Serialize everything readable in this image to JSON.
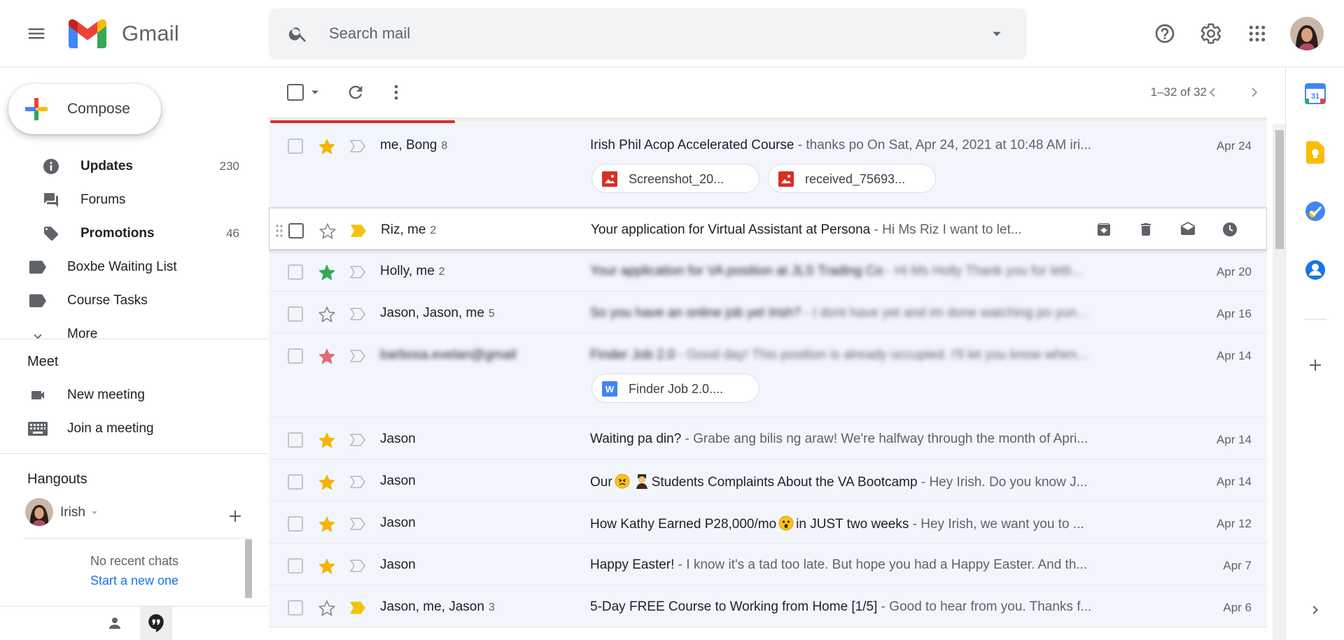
{
  "header": {
    "product_name": "Gmail",
    "search_placeholder": "Search mail"
  },
  "compose": {
    "label": "Compose"
  },
  "nav": {
    "items": [
      {
        "label": "Updates",
        "count": "230",
        "bold": true,
        "icon": "info-icon"
      },
      {
        "label": "Forums",
        "count": "",
        "bold": false,
        "icon": "forum-icon"
      },
      {
        "label": "Promotions",
        "count": "46",
        "bold": true,
        "icon": "tag-icon"
      },
      {
        "label": "Boxbe Waiting List",
        "count": "",
        "bold": false,
        "icon": "label-icon"
      },
      {
        "label": "Course Tasks",
        "count": "",
        "bold": false,
        "icon": "label-icon"
      },
      {
        "label": "More",
        "count": "",
        "bold": false,
        "icon": "chevron-down-icon"
      }
    ]
  },
  "meet": {
    "title": "Meet",
    "new_meeting": "New meeting",
    "join_meeting": "Join a meeting"
  },
  "hangouts": {
    "title": "Hangouts",
    "user_name": "Irish",
    "no_chats": "No recent chats",
    "start_new": "Start a new one"
  },
  "toolbar": {
    "pagination": "1–32 of 32"
  },
  "colors": {
    "star_yellow": "#f4b400",
    "star_green": "#34a853",
    "star_red": "#e56b6f",
    "important_yellow": "#f4c20d",
    "link_blue": "#1a73e8",
    "progress_red": "#d93025"
  },
  "messages": [
    {
      "sender": "me, Bong",
      "count": "8",
      "subject": "Irish Phil Acop Accelerated Course",
      "snippet": " - thanks po On Sat, Apr 24, 2021 at 10:48 AM iri...",
      "date": "Apr 24",
      "star": "yellow",
      "important": false,
      "blurred": false,
      "attachments": [
        {
          "name": "Screenshot_20...",
          "type": "image"
        },
        {
          "name": "received_75693...",
          "type": "image"
        }
      ]
    },
    {
      "sender": "Riz, me",
      "count": "2",
      "subject": "Your application for Virtual Assistant at Persona",
      "snippet": " - Hi Ms Riz I want to let...",
      "date": "",
      "star": "none",
      "important": true,
      "blurred": false,
      "hover": true,
      "attachments": []
    },
    {
      "sender": "Holly, me",
      "count": "2",
      "subject": "Your application for VA position at JLS Trading Co",
      "snippet": " - Hi Ms Holly Thank you for letti...",
      "date": "Apr 20",
      "star": "green",
      "important": false,
      "blurred": true,
      "attachments": []
    },
    {
      "sender": "Jason, Jason, me",
      "count": "5",
      "subject": "So you have an online job yet Irish?",
      "snippet": " - I dont have yet and im done watching po yun...",
      "date": "Apr 16",
      "star": "none",
      "important": false,
      "blurred": true,
      "attachments": []
    },
    {
      "sender": "barbosa.evelan@gmail",
      "count": "",
      "subject": "Finder Job 2.0",
      "snippet": " - Good day! This position is already occupied. I'll let you know when...",
      "date": "Apr 14",
      "star": "red",
      "important": false,
      "blurred": true,
      "sender_blurred": true,
      "attachments": [
        {
          "name": "Finder Job 2.0....",
          "type": "word"
        }
      ]
    },
    {
      "sender": "Jason",
      "count": "",
      "subject": "Waiting pa din?",
      "snippet": " - Grabe ang bilis ng araw! We're halfway through the month of Apri...",
      "date": "Apr 14",
      "star": "yellow",
      "important": false,
      "blurred": false,
      "attachments": []
    },
    {
      "sender": "Jason",
      "count": "",
      "subject_pre": "Our",
      "subject": "Students Complaints About the VA Bootcamp",
      "snippet": " - Hey Irish. Do you know J...",
      "date": "Apr 14",
      "star": "yellow",
      "important": false,
      "blurred": false,
      "emoji": "angry-face-and-teacher",
      "attachments": []
    },
    {
      "sender": "Jason",
      "count": "",
      "subject_pre": "How Kathy Earned P28,000/mo",
      "subject": "in JUST two weeks",
      "snippet": " - Hey Irish, we want you to ...",
      "date": "Apr 12",
      "star": "yellow",
      "important": false,
      "blurred": false,
      "emoji": "astonished-face",
      "attachments": []
    },
    {
      "sender": "Jason",
      "count": "",
      "subject": "Happy Easter!",
      "snippet": " - I know it's a tad too late. But hope you had a Happy Easter. And th...",
      "date": "Apr 7",
      "star": "yellow",
      "important": false,
      "blurred": false,
      "attachments": []
    },
    {
      "sender": "Jason, me, Jason",
      "count": "3",
      "subject": "5-Day FREE Course to Working from Home [1/5]",
      "snippet": " - Good to hear from you. Thanks f...",
      "date": "Apr 6",
      "star": "none",
      "important": true,
      "blurred": false,
      "attachments": []
    }
  ]
}
